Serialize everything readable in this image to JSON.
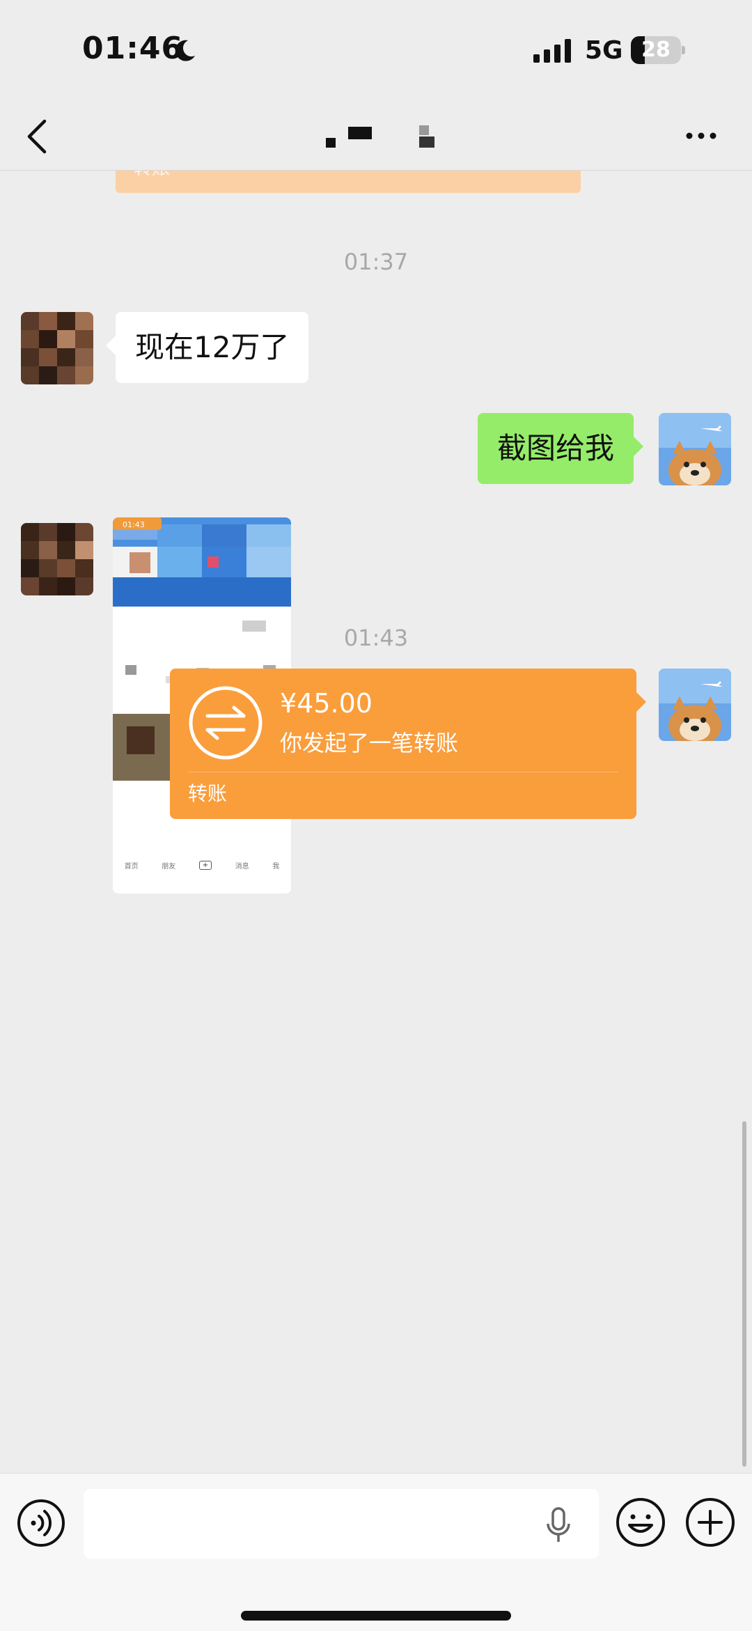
{
  "status_bar": {
    "time": "01:46",
    "network": "5G",
    "battery_level": "28",
    "battery_fraction": 0.28
  },
  "nav": {
    "back_icon": "chevron-left-icon",
    "title": "",
    "more_icon": "more-dots-icon"
  },
  "messages": {
    "partial_transfer_label": "转账",
    "timestamp_1": "01:37",
    "msg_in_1": "现在12万了",
    "msg_out_1": "截图给我",
    "timestamp_2": "01:43",
    "transfer": {
      "amount": "¥45.00",
      "description": "你发起了一笔转账",
      "label": "转账",
      "icon": "transfer-arrows-icon"
    },
    "image_preview": {
      "time_badge": "01:43",
      "tabs": [
        "首页",
        "朋友",
        "+",
        "消息",
        "我"
      ]
    }
  },
  "input_bar": {
    "voice_icon": "voice-icon",
    "placeholder": "",
    "mic_icon": "mic-icon",
    "emoji_icon": "emoji-icon",
    "plus_icon": "plus-icon"
  },
  "colors": {
    "background": "#ededed",
    "incoming_bubble": "#ffffff",
    "outgoing_bubble": "#95ec69",
    "transfer_card": "#fa9d3b",
    "timestamp_text": "#a8a8a8"
  }
}
